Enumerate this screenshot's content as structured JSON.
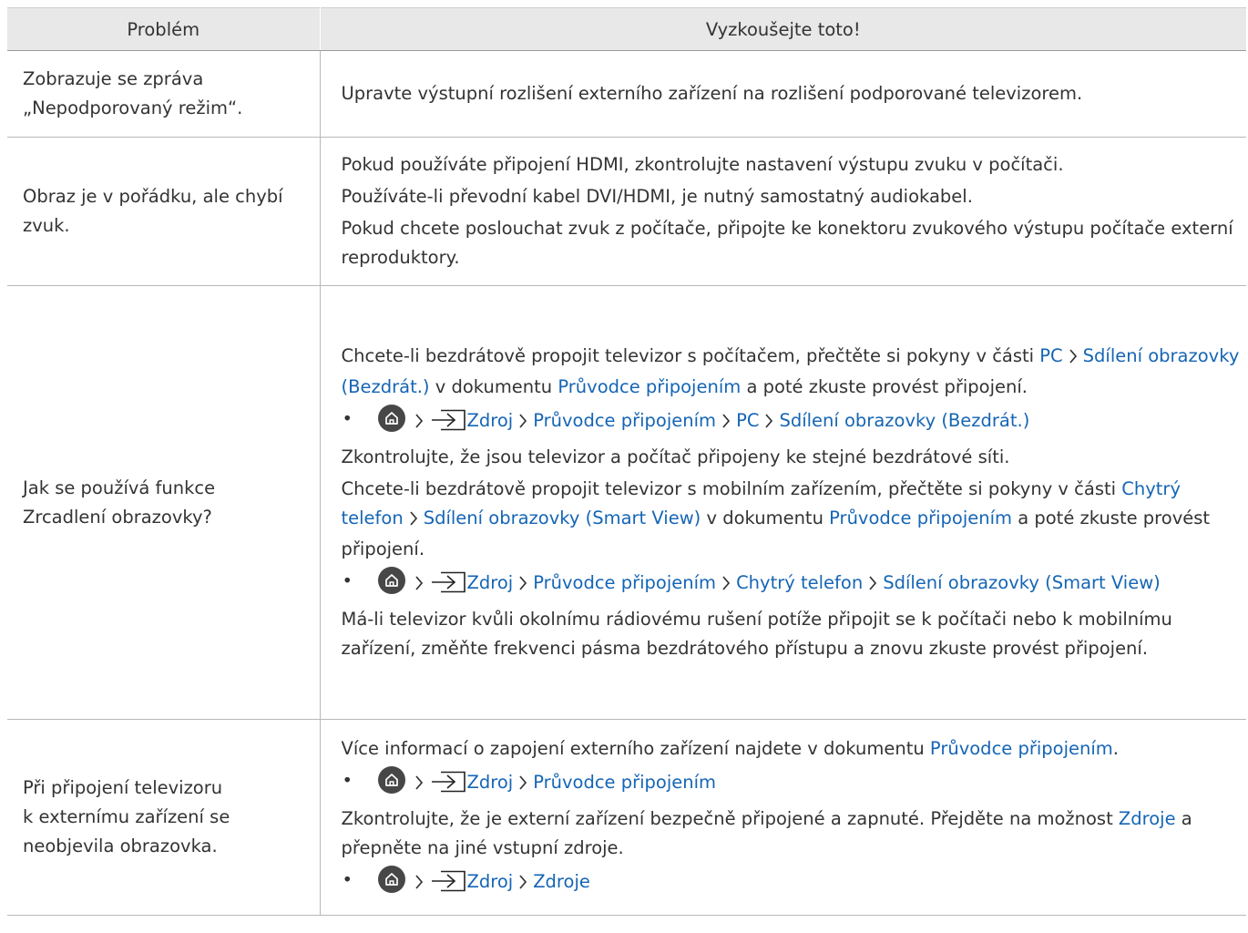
{
  "table": {
    "headers": [
      "Problém",
      "Vyzkoušejte toto!"
    ],
    "rows": [
      {
        "problem": [
          "Zobrazuje se zpráva",
          "„Nepodporovaný režim“."
        ],
        "solution": [
          "Upravte výstupní rozlišení externího zařízení na rozlišení podporované televizorem."
        ]
      },
      {
        "problem": [
          "Obraz je v pořádku, ale chybí",
          "zvuk."
        ],
        "solution": [
          "Pokud používáte připojení HDMI, zkontrolujte nastavení výstupu zvuku v počítači.",
          "Používáte-li převodní kabel DVI/HDMI, je nutný samostatný audiokabel.",
          "Pokud chcete poslouchat zvuk z počítače, připojte ke konektoru zvukového výstupu počítače externí reproduktory."
        ]
      },
      {
        "problem": [
          "Jak se používá funkce",
          "Zrcadlení obrazovky?"
        ],
        "solution_p1": {
          "pre": "Chcete-li bezdrátově propojit televizor s počítačem, přečtěte si pokyny v části ",
          "link1": "PC",
          "link2": "Sdílení obrazovky (Bezdrát.)",
          "mid": " v dokumentu ",
          "link3": "Průvodce připojením",
          "post": " a poté zkuste provést připojení."
        },
        "path1": [
          "Zdroj",
          "Průvodce připojením",
          "PC",
          "Sdílení obrazovky (Bezdrát.)"
        ],
        "solution_p2": "Zkontrolujte, že jsou televizor a počítač připojeny ke stejné bezdrátové síti.",
        "solution_p3": {
          "pre": "Chcete-li bezdrátově propojit televizor s mobilním zařízením, přečtěte si pokyny v části ",
          "link1": "Chytrý telefon",
          "link2": "Sdílení obrazovky (Smart View)",
          "mid": " v dokumentu ",
          "link3": "Průvodce připojením",
          "post": " a poté zkuste provést připojení."
        },
        "path2": [
          "Zdroj",
          "Průvodce připojením",
          "Chytrý telefon",
          "Sdílení obrazovky (Smart View)"
        ],
        "solution_p4": "Má-li televizor kvůli okolnímu rádiovému rušení potíže připojit se k počítači nebo k mobilnímu zařízení, změňte frekvenci pásma bezdrátového přístupu a znovu zkuste provést připojení."
      },
      {
        "problem": [
          "Při připojení televizoru",
          "k externímu zařízení se",
          "neobjevila obrazovka."
        ],
        "solution_p1": {
          "pre": "Více informací o zapojení externího zařízení najdete v dokumentu ",
          "link": "Průvodce připojením",
          "post": "."
        },
        "path1": [
          "Zdroj",
          "Průvodce připojením"
        ],
        "solution_p2": {
          "pre": "Zkontrolujte, že je externí zařízení bezpečně připojené a zapnuté. Přejděte na možnost ",
          "link": "Zdroje",
          "post": " a přepněte na jiné vstupní zdroje."
        },
        "path2": [
          "Zdroj",
          "Zdroje"
        ]
      }
    ]
  },
  "icons": {
    "home": "home-icon",
    "source": "source-input-icon",
    "chevron": "chevron-right-icon",
    "bullet": "•"
  },
  "colors": {
    "link": "#1565b5",
    "header_bg": "#e8e8e8",
    "text": "#333333",
    "home_icon_bg": "#474747"
  }
}
